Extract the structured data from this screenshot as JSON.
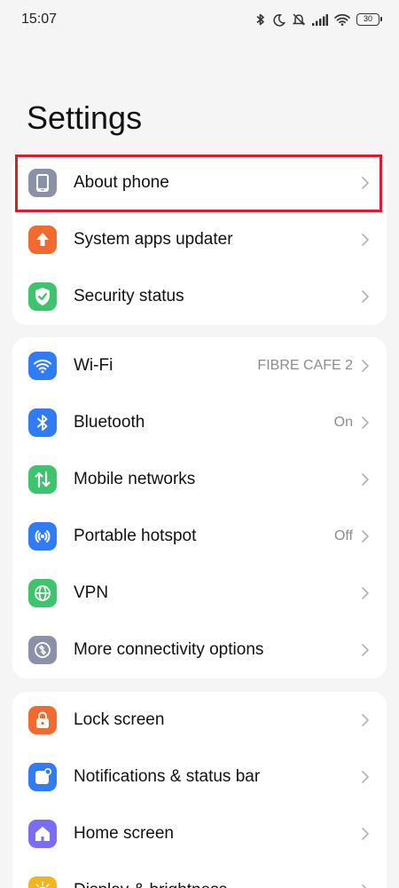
{
  "status_bar": {
    "time": "15:07",
    "battery": "30",
    "icons": [
      "bluetooth-icon",
      "moon-icon",
      "bell-off-icon",
      "signal-icon",
      "wifi-icon",
      "battery-icon"
    ]
  },
  "page": {
    "title": "Settings"
  },
  "groups": [
    {
      "items": [
        {
          "label": "About phone",
          "value": "",
          "icon": "phone-icon",
          "color": "#8a91a8",
          "highlighted": true
        },
        {
          "label": "System apps updater",
          "value": "",
          "icon": "arrow-up-icon",
          "color": "#f26a2e"
        },
        {
          "label": "Security status",
          "value": "",
          "icon": "shield-check-icon",
          "color": "#3ec46d"
        }
      ]
    },
    {
      "items": [
        {
          "label": "Wi-Fi",
          "value": "FIBRE CAFE 2",
          "icon": "wifi-icon",
          "color": "#2f7cf6"
        },
        {
          "label": "Bluetooth",
          "value": "On",
          "icon": "bluetooth-icon",
          "color": "#2f7cf6"
        },
        {
          "label": "Mobile networks",
          "value": "",
          "icon": "data-arrows-icon",
          "color": "#3ec46d"
        },
        {
          "label": "Portable hotspot",
          "value": "Off",
          "icon": "hotspot-icon",
          "color": "#2f7cf6"
        },
        {
          "label": "VPN",
          "value": "",
          "icon": "globe-icon",
          "color": "#3ec46d"
        },
        {
          "label": "More connectivity options",
          "value": "",
          "icon": "link-icon",
          "color": "#8a91a8"
        }
      ]
    },
    {
      "items": [
        {
          "label": "Lock screen",
          "value": "",
          "icon": "lock-icon",
          "color": "#f26a2e"
        },
        {
          "label": "Notifications & status bar",
          "value": "",
          "icon": "notification-icon",
          "color": "#2f7cf6"
        },
        {
          "label": "Home screen",
          "value": "",
          "icon": "home-icon",
          "color": "#7b6cf6"
        },
        {
          "label": "Display & brightness",
          "value": "",
          "icon": "sun-icon",
          "color": "#f5b41a"
        }
      ]
    }
  ]
}
